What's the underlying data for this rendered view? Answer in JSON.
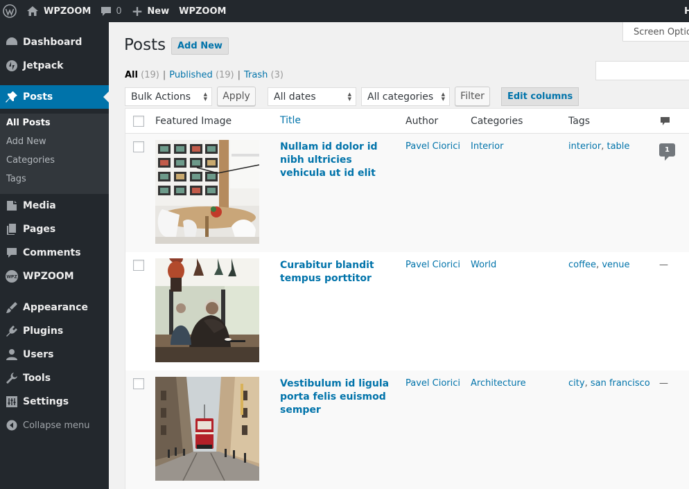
{
  "admin_bar": {
    "site_name": "WPZOOM",
    "comments_count": "0",
    "new_label": "New",
    "plugin_label": "WPZOOM",
    "howdy": "H"
  },
  "sidebar": {
    "items": [
      {
        "label": "Dashboard",
        "icon": "dashboard-icon"
      },
      {
        "label": "Jetpack",
        "icon": "jetpack-icon"
      },
      {
        "label": "Posts",
        "icon": "pin-icon"
      },
      {
        "label": "Media",
        "icon": "media-icon"
      },
      {
        "label": "Pages",
        "icon": "pages-icon"
      },
      {
        "label": "Comments",
        "icon": "comments-icon"
      },
      {
        "label": "WPZOOM",
        "icon": "wpzoom-icon"
      },
      {
        "label": "Appearance",
        "icon": "appearance-icon"
      },
      {
        "label": "Plugins",
        "icon": "plugins-icon"
      },
      {
        "label": "Users",
        "icon": "users-icon"
      },
      {
        "label": "Tools",
        "icon": "tools-icon"
      },
      {
        "label": "Settings",
        "icon": "settings-icon"
      }
    ],
    "submenu": [
      "All Posts",
      "Add New",
      "Categories",
      "Tags"
    ],
    "collapse_label": "Collapse menu"
  },
  "screen_options": "Screen Options",
  "page": {
    "title": "Posts",
    "add_new": "Add New"
  },
  "views": {
    "all": "All",
    "all_count": "(19)",
    "published": "Published",
    "published_count": "(19)",
    "trash": "Trash",
    "trash_count": "(3)",
    "sep": "|"
  },
  "toolbar": {
    "bulk_actions": "Bulk Actions",
    "apply": "Apply",
    "dates": "All dates",
    "categories": "All categories",
    "filter": "Filter",
    "edit_columns": "Edit columns"
  },
  "table": {
    "headers": {
      "featured_image": "Featured Image",
      "title": "Title",
      "author": "Author",
      "categories": "Categories",
      "tags": "Tags"
    },
    "rows": [
      {
        "title": "Nullam id dolor id nibh ultricies vehicula ut id elit",
        "author": "Pavel Ciorici",
        "category": "Interior",
        "tag1": "interior",
        "tag_sep": ", ",
        "tag2": "table",
        "comments": "1",
        "image": "dining-room-photo"
      },
      {
        "title": "Curabitur blandit tempus porttitor",
        "author": "Pavel Ciorici",
        "category": "World",
        "tag1": "coffee",
        "tag_sep": ", ",
        "tag2": "venue",
        "comments": "—",
        "image": "cafe-man-photo"
      },
      {
        "title": "Vestibulum id ligula porta felis euismod semper",
        "author": "Pavel Ciorici",
        "category": "Architecture",
        "tag1": "city",
        "tag_sep": ", ",
        "tag2": "san francisco",
        "comments": "—",
        "image": "street-tram-photo"
      }
    ]
  },
  "colors": {
    "admin_dark": "#23282d",
    "accent": "#0073aa",
    "submenu_bg": "#32373c"
  }
}
